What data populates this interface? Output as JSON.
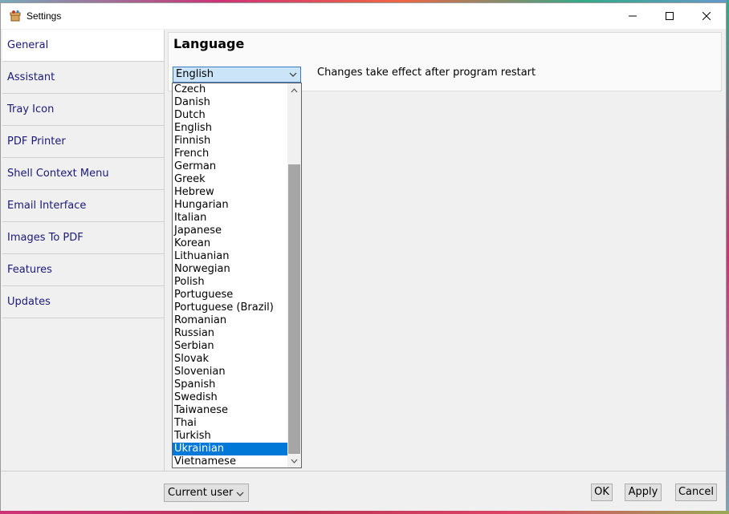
{
  "window": {
    "title": "Settings"
  },
  "sidebar": {
    "items": [
      {
        "label": "General",
        "active": true
      },
      {
        "label": "Assistant"
      },
      {
        "label": "Tray Icon"
      },
      {
        "label": "PDF Printer"
      },
      {
        "label": "Shell Context Menu"
      },
      {
        "label": "Email Interface"
      },
      {
        "label": "Images To PDF"
      },
      {
        "label": "Features"
      },
      {
        "label": "Updates"
      }
    ]
  },
  "language": {
    "title": "Language",
    "selected": "English",
    "note": "Changes take effect after program restart",
    "highlighted": "Ukrainian",
    "options": [
      "Czech",
      "Danish",
      "Dutch",
      "English",
      "Finnish",
      "French",
      "German",
      "Greek",
      "Hebrew",
      "Hungarian",
      "Italian",
      "Japanese",
      "Korean",
      "Lithuanian",
      "Norwegian",
      "Polish",
      "Portuguese",
      "Portuguese (Brazil)",
      "Romanian",
      "Russian",
      "Serbian",
      "Slovak",
      "Slovenian",
      "Spanish",
      "Swedish",
      "Taiwanese",
      "Thai",
      "Turkish",
      "Ukrainian",
      "Vietnamese"
    ]
  },
  "footer": {
    "scope": "Current user",
    "ok": "OK",
    "apply": "Apply",
    "cancel": "Cancel"
  },
  "colors": {
    "accent": "#0078d7",
    "sidebar_text": "#1a1a7a"
  }
}
